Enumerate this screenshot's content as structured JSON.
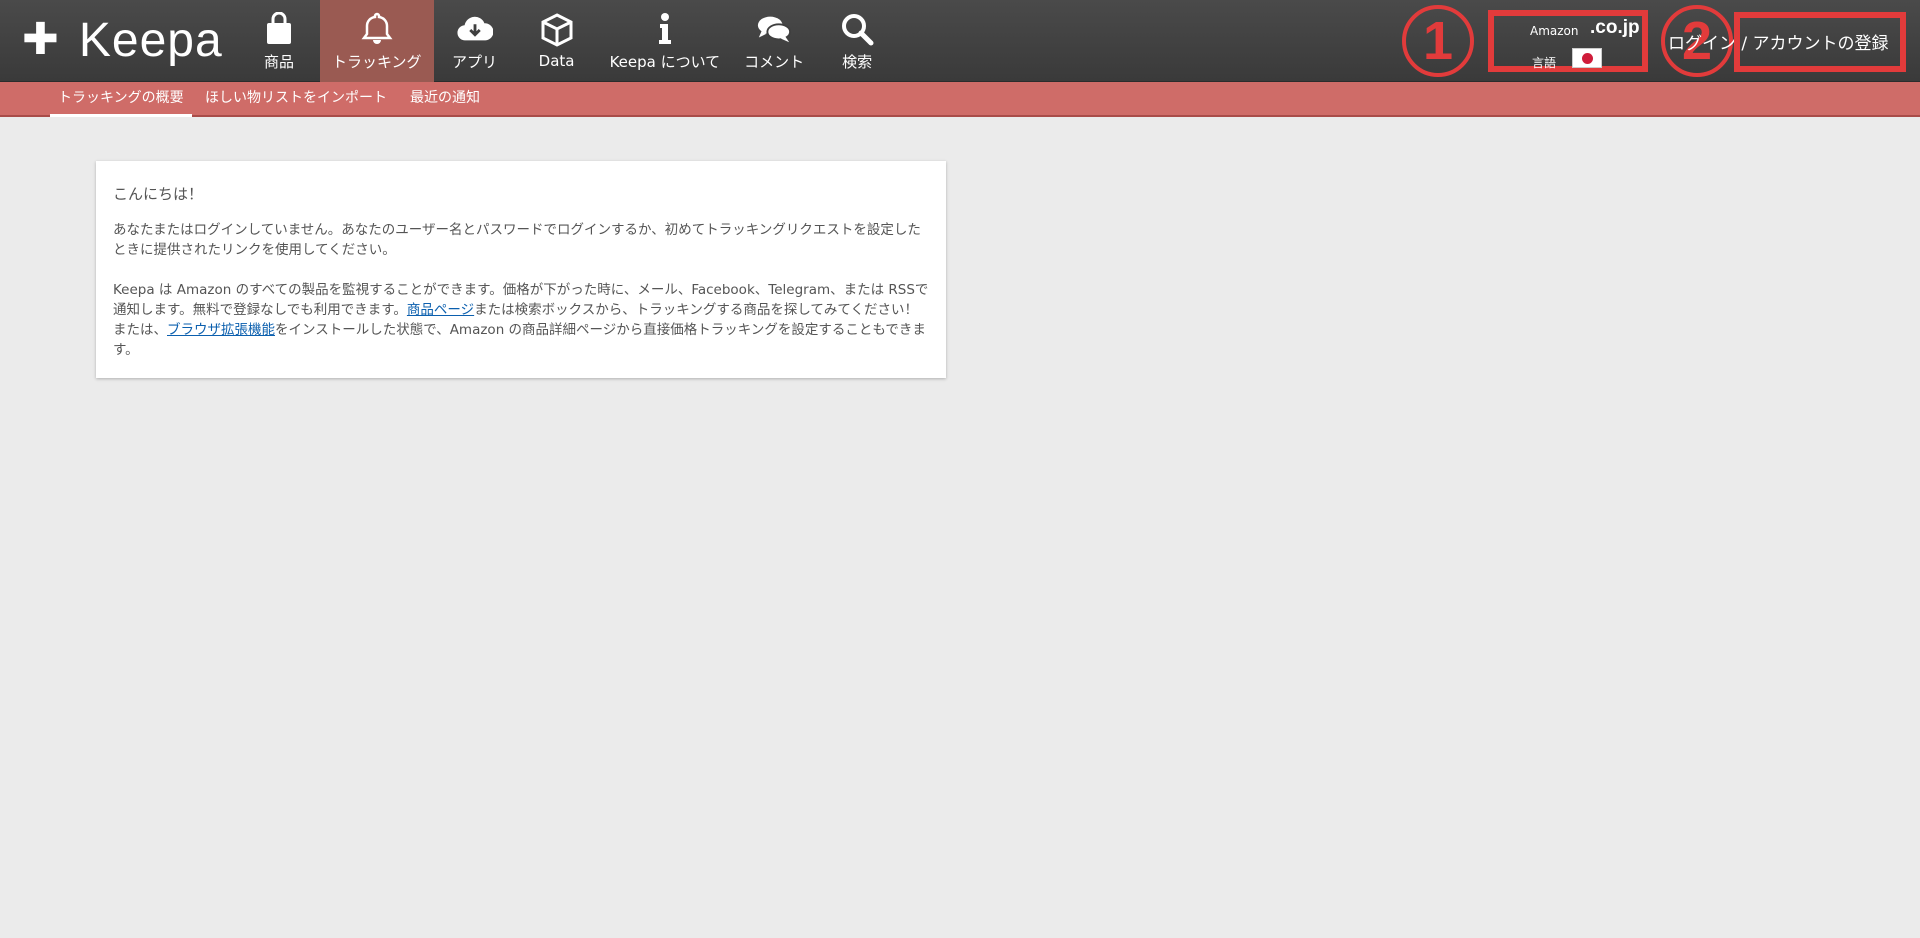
{
  "logo": {
    "name": "Keepa"
  },
  "nav": [
    {
      "label": "商品",
      "icon": "shopping-bag-icon"
    },
    {
      "label": "トラッキング",
      "icon": "bell-icon",
      "active": true
    },
    {
      "label": "アプリ",
      "icon": "cloud-download-icon"
    },
    {
      "label": "Data",
      "icon": "cube-icon"
    },
    {
      "label": "Keepa について",
      "icon": "info-icon"
    },
    {
      "label": "コメント",
      "icon": "comments-icon"
    },
    {
      "label": "検索",
      "icon": "search-icon"
    }
  ],
  "region": {
    "amazon_label": "Amazon",
    "domain": ".co.jp",
    "language_label": "言語",
    "flag": "japan-flag-icon"
  },
  "annotations": {
    "one": "1",
    "two": "2"
  },
  "account": {
    "login_label": "ログイン / アカウントの登録"
  },
  "subnav": [
    {
      "label": "トラッキングの概要",
      "active": true
    },
    {
      "label": "ほしい物リストをインポート"
    },
    {
      "label": "最近の通知"
    }
  ],
  "card": {
    "greeting": "こんにちは！",
    "para1": "あなたまたはログインしていません。あなたのユーザー名とパスワードでログインするか、初めてトラッキングリクエストを設定したときに提供されたリンクを使用してください。",
    "para2_part1": "Keepa は Amazon のすべての製品を監視することができます。価格が下がった時に、メール、Facebook、Telegram、または RSSで通知します。無料で登録なしでも利用できます。",
    "link_product_page": "商品ページ",
    "para2_part2": "または検索ボックスから、トラッキングする商品を探してみてください！ または、",
    "link_browser_extension": "ブラウザ拡張機能",
    "para2_part3": "をインストールした状態で、Amazon の商品詳細ページから直接価格トラッキングを設定することもできます。"
  },
  "colors": {
    "topbar": "#3f3f3f",
    "active_tab": "#9a5a52",
    "subbar": "#cf6c68",
    "annotation": "#e23b3b",
    "link": "#0b5fae",
    "background": "#ebebeb"
  }
}
